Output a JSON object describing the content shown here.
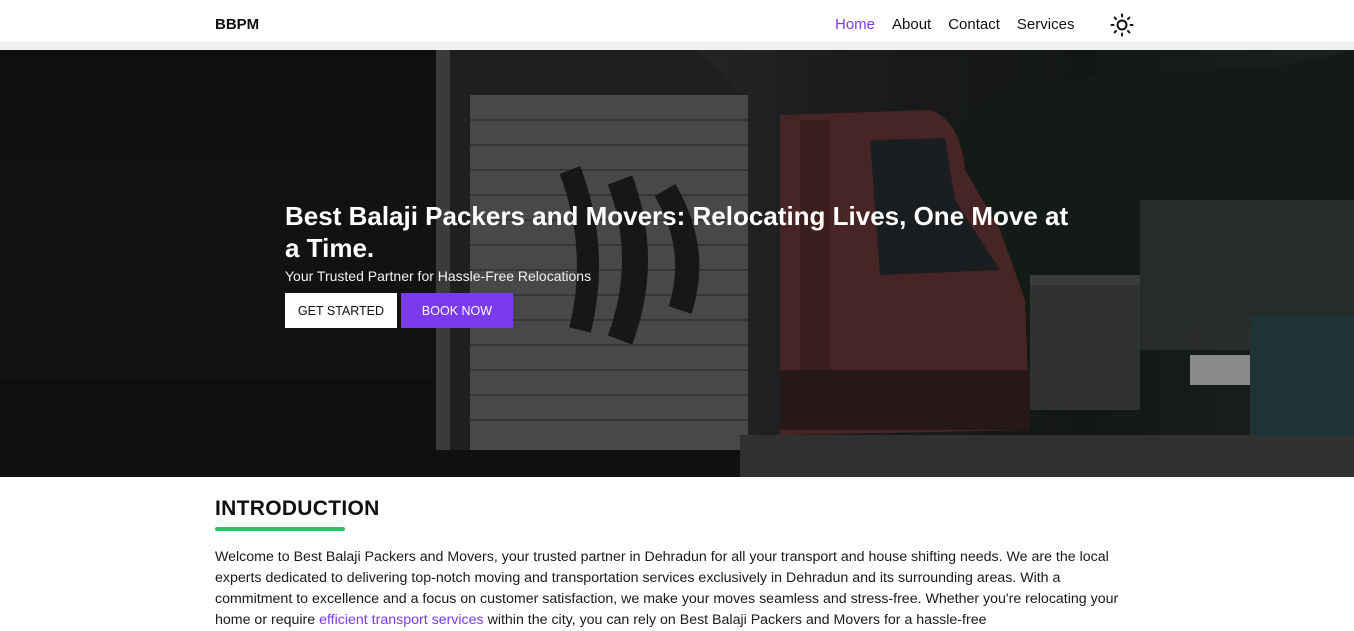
{
  "nav": {
    "brand": "BBPM",
    "links": [
      {
        "label": "Home",
        "active": true
      },
      {
        "label": "About",
        "active": false
      },
      {
        "label": "Contact",
        "active": false
      },
      {
        "label": "Services",
        "active": false
      }
    ],
    "theme_icon": "sun-icon"
  },
  "hero": {
    "title": "Best Balaji Packers and Movers: Relocating Lives, One Move at a Time.",
    "subtitle": "Your Trusted Partner for Hassle-Free Relocations",
    "get_started_label": "GET STARTED",
    "book_now_label": "BOOK NOW",
    "background": "photo of a red truck with a silver cargo box"
  },
  "intro": {
    "heading": "INTRODUCTION",
    "text_before_link": "Welcome to Best Balaji Packers and Movers, your trusted partner in Dehradun for all your transport and house shifting needs. We are the local experts dedicated to delivering top-notch moving and transportation services exclusively in Dehradun and its surrounding areas. With a commitment to excellence and a focus on customer satisfaction, we make your moves seamless and stress-free. Whether you're relocating your home or require ",
    "link_text": "efficient transport services",
    "text_after_link": " within the city, you can rely on Best Balaji Packers and Movers for a hassle-free"
  },
  "colors": {
    "accent": "#7c3aed",
    "underline": "#22c55e"
  }
}
